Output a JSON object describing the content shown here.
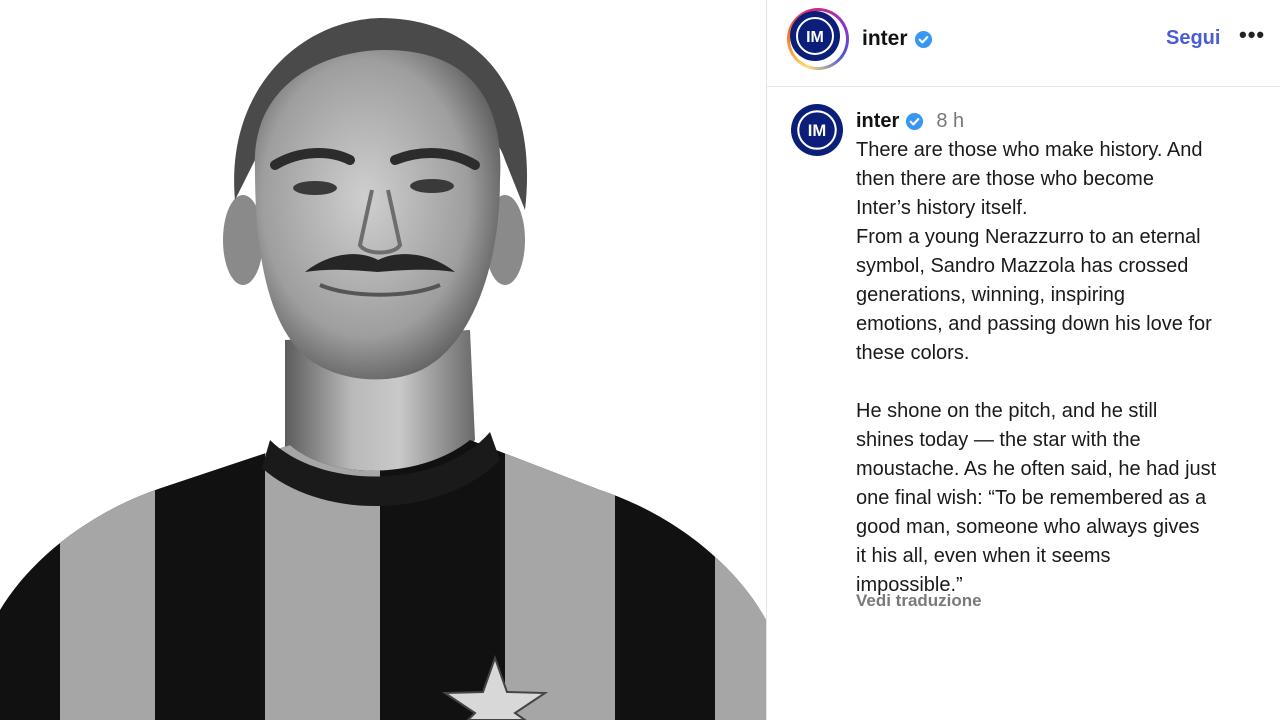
{
  "header": {
    "username": "inter",
    "follow_label": "Segui",
    "more_label": "•••"
  },
  "caption": {
    "username": "inter",
    "time": "8 h",
    "lines": [
      "There are those who make history. And",
      "then there are those who become",
      "Inter’s history itself.",
      "From a young Nerazzurro to an eternal",
      "symbol, Sandro Mazzola has crossed",
      "generations, winning, inspiring",
      "emotions, and passing down his love for",
      "these colors.",
      "",
      "He shone on the pitch, and he still",
      "shines today — the star with the",
      "moustache. As he often said, he had just",
      "one final wish: “To be remembered as a",
      "good man, someone who always gives",
      "it his all, even when it seems",
      "impossible.”"
    ],
    "translate_label": "Vedi traduzione"
  },
  "logo_text": "IM",
  "colors": {
    "inter_blue": "#0a1e7a",
    "verified": "#3897f0",
    "follow": "#4a5dd6"
  }
}
